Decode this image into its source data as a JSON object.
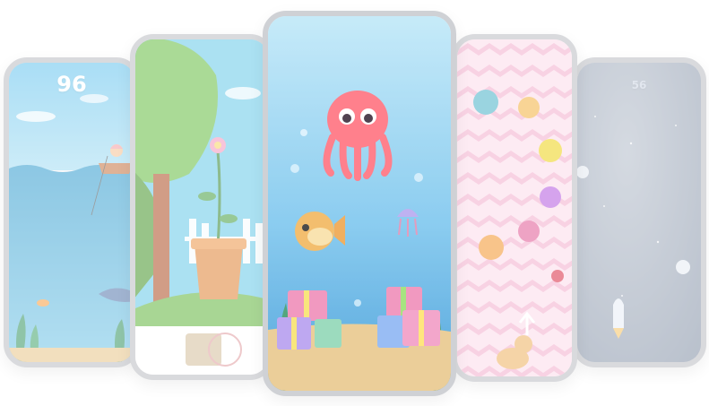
{
  "screens": [
    {
      "id": "fishing",
      "score": "96"
    },
    {
      "id": "garden"
    },
    {
      "id": "ocean"
    },
    {
      "id": "candy"
    },
    {
      "id": "space",
      "score": "56"
    }
  ],
  "colors": {
    "frame": "#d9dadd",
    "ocean_top": "#bfe7f6",
    "ocean_bottom": "#2f8fd4",
    "octopus": "#ff6f7d",
    "candy_stripe_a": "#fde6f0",
    "candy_stripe_b": "#f7c6dc",
    "space": "#9aa6b8"
  }
}
